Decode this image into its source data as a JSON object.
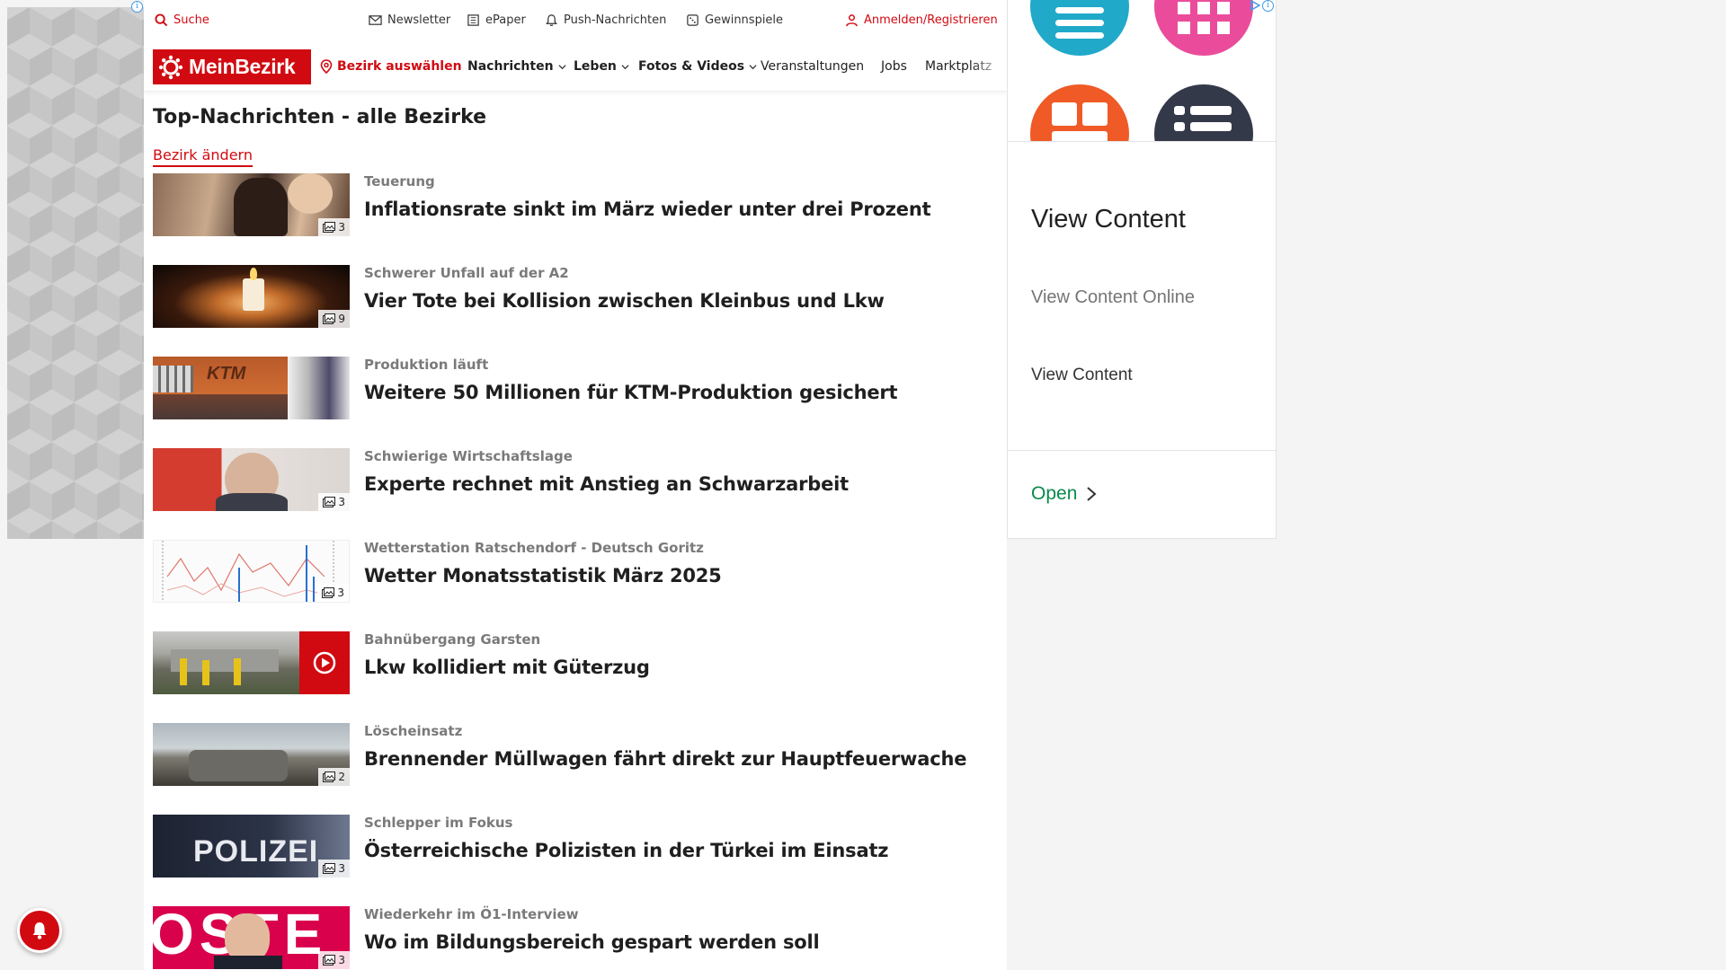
{
  "utility_bar": {
    "search": "Suche",
    "newsletter": "Newsletter",
    "epaper": "ePaper",
    "push": "Push-Nachrichten",
    "games": "Gewinnspiele",
    "login": "Anmelden/Registrieren"
  },
  "nav": {
    "logo": "MeinBezirk",
    "district": "Bezirk auswählen",
    "items": [
      "Nachrichten",
      "Leben",
      "Fotos & Videos",
      "Veranstaltungen",
      "Jobs",
      "Marktplatz"
    ]
  },
  "page": {
    "title": "Top-Nachrichten - alle Bezirke",
    "change_district": "Bezirk ändern"
  },
  "articles": [
    {
      "kicker": "Teuerung",
      "headline": "Inflationsrate sinkt im März wieder unter drei Prozent",
      "images": "3",
      "thumb": "hairdresser"
    },
    {
      "kicker": "Schwerer Unfall auf der A2",
      "headline": "Vier Tote bei Kollision zwischen Kleinbus und Lkw",
      "images": "9",
      "thumb": "candle"
    },
    {
      "kicker": "Produktion läuft",
      "headline": "Weitere 50 Millionen für KTM-Produktion gesichert",
      "images": "",
      "thumb": "ktm"
    },
    {
      "kicker": "Schwierige Wirtschaftslage",
      "headline": "Experte rechnet mit Anstieg an Schwarzarbeit",
      "images": "3",
      "thumb": "expert"
    },
    {
      "kicker": "Wetterstation Ratschendorf - Deutsch Goritz",
      "headline": "Wetter Monatsstatistik März 2025",
      "images": "3",
      "thumb": "chart"
    },
    {
      "kicker": "Bahnübergang Garsten",
      "headline": "Lkw kollidiert mit Güterzug",
      "images": "",
      "thumb": "train",
      "video": true
    },
    {
      "kicker": "Löscheinsatz",
      "headline": "Brennender Müllwagen fährt direkt zur Hauptfeuerwache",
      "images": "2",
      "thumb": "garbage"
    },
    {
      "kicker": "Schlepper im Fokus",
      "headline": "Österreichische Polizisten in der Türkei im Einsatz",
      "images": "3",
      "thumb": "police",
      "thumb_text": "POLIZEI"
    },
    {
      "kicker": "Wiederkehr im Ö1-Interview",
      "headline": "Wo im Bildungsbereich gespart werden soll",
      "images": "3",
      "thumb": "interview",
      "thumb_text": "OSTE"
    }
  ],
  "ad": {
    "title": "View Content",
    "subtitle": "View Content Online",
    "subtitle2": "View Content",
    "cta": "Open",
    "info_glyph": "i"
  },
  "colors": {
    "brand_red": "#d10a11",
    "ad_green": "#0a8a4a"
  }
}
